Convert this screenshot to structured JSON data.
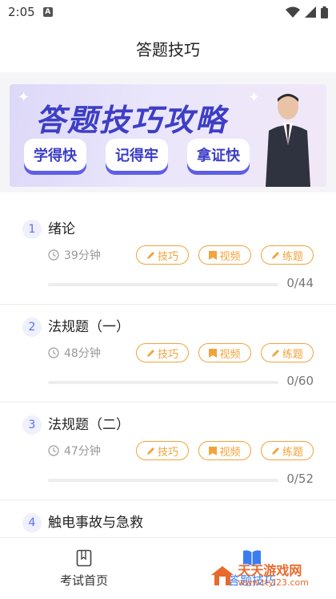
{
  "status_bar": {
    "time": "2:05",
    "app_icon_letter": "A"
  },
  "header": {
    "title": "答题技巧"
  },
  "banner": {
    "title": "答题技巧攻略",
    "pills": [
      "学得快",
      "记得牢",
      "拿证快"
    ]
  },
  "lessons": [
    {
      "num": "1",
      "title": "绪论",
      "duration": "39分钟",
      "tags": [
        "技巧",
        "视频",
        "练题"
      ],
      "progress": "0/44",
      "progress_fraction": 0
    },
    {
      "num": "2",
      "title": "法规题（一）",
      "duration": "48分钟",
      "tags": [
        "技巧",
        "视频",
        "练题"
      ],
      "progress": "0/60",
      "progress_fraction": 0
    },
    {
      "num": "3",
      "title": "法规题（二）",
      "duration": "47分钟",
      "tags": [
        "技巧",
        "视频",
        "练题"
      ],
      "progress": "0/52",
      "progress_fraction": 0
    },
    {
      "num": "4",
      "title": "触电事故与急救"
    }
  ],
  "tabbar": {
    "home_label": "考试首页",
    "tips_label": "答题技巧",
    "active_color": "#3a7df2"
  },
  "watermark": {
    "brand": "天天游戏网",
    "url": "www.ttyl23.com"
  },
  "colors": {
    "accent": "#5a6ff0",
    "tag": "#f2a33a",
    "banner_text": "#3d3ec6"
  }
}
